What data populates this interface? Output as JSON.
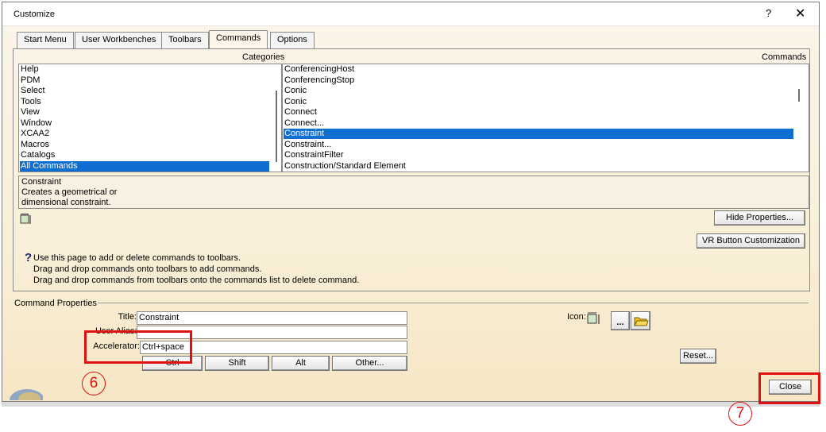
{
  "window": {
    "title": "Customize",
    "help_glyph": "?",
    "close_glyph": "✕"
  },
  "tabs": [
    "Start Menu",
    "User Workbenches",
    "Toolbars",
    "Commands",
    "Options"
  ],
  "headers": {
    "categories": "Categories",
    "commands": "Commands"
  },
  "categories": {
    "items": [
      "Help",
      "PDM",
      "Select",
      "Tools",
      "View",
      "Window",
      "XCAA2",
      "Macros",
      "Catalogs",
      "All Commands"
    ],
    "selected": "All Commands"
  },
  "commands": {
    "items": [
      "ConferencingHost",
      "ConferencingStop",
      "Conic",
      "Conic",
      "Connect",
      "Connect...",
      "Constraint",
      "Constraint...",
      "ConstraintFilter",
      "Construction/Standard Element"
    ],
    "selected": "Constraint"
  },
  "description": {
    "lines": [
      "Constraint",
      "Creates a geometrical or",
      "dimensional constraint."
    ]
  },
  "buttons": {
    "hide_properties": "Hide Properties...",
    "vr_customization": "VR Button Customization",
    "ctrl": "Ctrl",
    "shift": "Shift",
    "alt": "Alt",
    "other": "Other...",
    "reset": "Reset...",
    "close": "Close",
    "browse": "..."
  },
  "info": {
    "icon_glyph": "?",
    "lines": [
      "Use this page to add or delete commands to toolbars.",
      "Drag and drop commands onto toolbars to add commands.",
      "Drag and drop commands from toolbars onto the commands list to delete command."
    ]
  },
  "command_properties": {
    "group_label": "Command Properties",
    "title_label": "Title:",
    "title_value": "Constraint",
    "alias_label": "User Alias:",
    "alias_value": "",
    "accelerator_label": "Accelerator:",
    "accelerator_value": "Ctrl+space",
    "icon_label": "Icon:"
  },
  "annotations": {
    "step6": "6",
    "step7": "7"
  },
  "colors": {
    "selection": "#0f6fd1",
    "annotation": "#e01010"
  }
}
